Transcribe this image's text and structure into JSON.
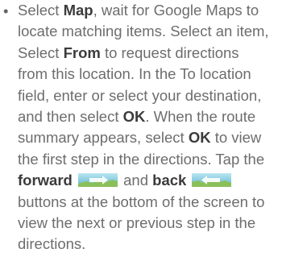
{
  "bullet": "•",
  "lines": {
    "l1": {
      "a": "Select ",
      "b": "Map",
      "c": ", wait for Google Maps to"
    },
    "l2": {
      "a": "locate matching items. Select an item,"
    },
    "l3": {
      "a": "Select ",
      "b": "From",
      "c": " to request directions"
    },
    "l4": {
      "a": "from this location. In the To location"
    },
    "l5": {
      "a": "field, enter or select your destination,"
    },
    "l6": {
      "a": "and then select ",
      "b": "OK",
      "c": ". When the route"
    },
    "l7": {
      "a": "summary appears, select ",
      "b": "OK",
      "c": " to view"
    },
    "l8": {
      "a": "the first step in the directions. Tap the"
    },
    "l9": {
      "b1": "forward",
      "b2": "and ",
      "b3": "back"
    },
    "l10": {
      "a": "buttons at the bottom of the screen to"
    },
    "l11": {
      "a": "view the next or previous step in the"
    },
    "l12": {
      "a": "directions."
    }
  },
  "icons": {
    "forward": "forward-button-icon",
    "back": "back-button-icon"
  }
}
